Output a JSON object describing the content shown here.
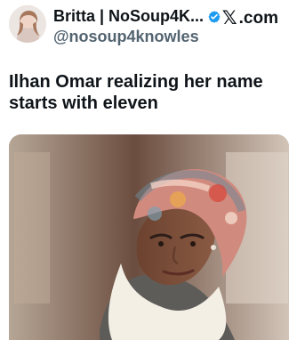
{
  "header": {
    "display_name": "Britta | NoSoup4K...",
    "handle": "@nosoup4knowles",
    "platform": ".com",
    "platform_mark": "𝕏"
  },
  "post": {
    "text": "Ilhan Omar realizing her name starts with eleven"
  },
  "image": {
    "alt": "Woman wearing a floral headscarf and white scarf outdoors"
  },
  "colors": {
    "verified": "#1d9bf0",
    "muted_text": "#536471"
  },
  "icons": {
    "verified": "verified-badge-icon",
    "platform": "x-logo-icon"
  }
}
